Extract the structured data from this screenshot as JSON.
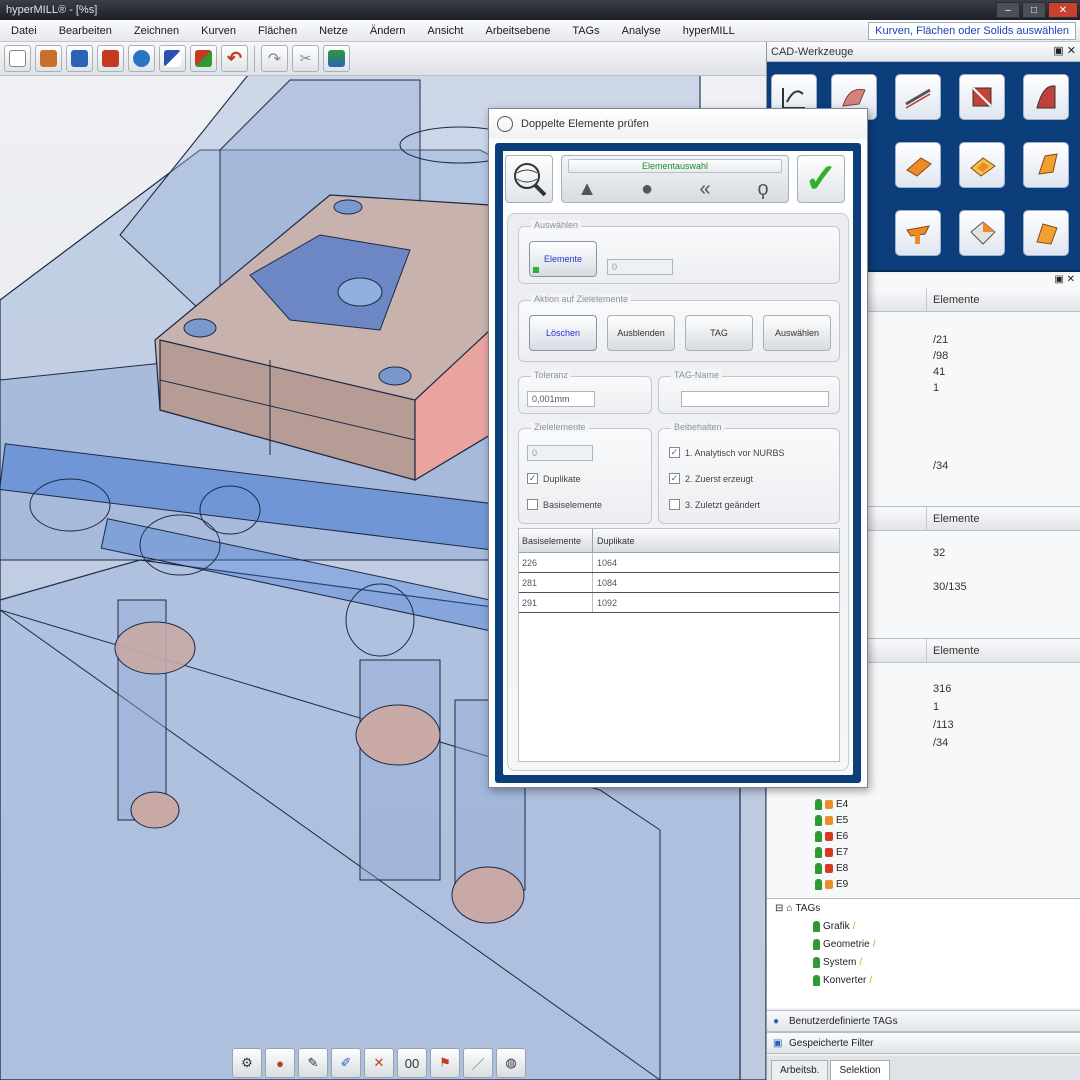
{
  "window": {
    "title": "hyperMILL® - [%s]"
  },
  "menu": {
    "items": [
      "Datei",
      "Bearbeiten",
      "Zeichnen",
      "Kurven",
      "Flächen",
      "Netze",
      "Ändern",
      "Ansicht",
      "Arbeitsebene",
      "TAGs",
      "Analyse",
      "hyperMILL"
    ],
    "hint": "Kurven, Flächen oder Solids auswählen"
  },
  "toolbar": {
    "icons": [
      "new-file-icon",
      "open-folder-icon",
      "save-icon",
      "book-icon",
      "tool-wheel-icon",
      "pencil-blue-icon",
      "pencil-red-icon",
      "undo-icon",
      "redo-icon",
      "cut-icon",
      "paste-icon"
    ]
  },
  "cad_tools": {
    "title": "CAD-Werkzeuge",
    "controls": "▣ ✕"
  },
  "elements_panels": [
    {
      "header": "Elemente",
      "values": [
        "/21",
        "/98",
        "41",
        "1",
        "/34"
      ]
    },
    {
      "header": "Elemente",
      "values": [
        "32",
        "30/135"
      ]
    },
    {
      "header": "Elemente",
      "values": [
        "316",
        "1",
        "/113",
        "/34"
      ]
    }
  ],
  "layer_tree": {
    "items": [
      {
        "label": "E4",
        "color": "#e8912a"
      },
      {
        "label": "E5",
        "color": "#e8912a"
      },
      {
        "label": "E6",
        "color": "#d33a22"
      },
      {
        "label": "E7",
        "color": "#d33a22"
      },
      {
        "label": "E8",
        "color": "#d33a22"
      },
      {
        "label": "E9",
        "color": "#e8912a"
      }
    ]
  },
  "tags_tree": {
    "root": "TAGs",
    "items": [
      "Grafik",
      "Geometrie",
      "System",
      "Konverter"
    ]
  },
  "footer": {
    "user_tags": "Benutzerdefinierte TAGs",
    "saved_filter": "Gespeicherte Filter",
    "tabs": [
      "Arbeitsb.",
      "Selektion"
    ]
  },
  "dialog": {
    "title": "Doppelte Elemente prüfen",
    "action_bar_label": "Elementauswahl",
    "selection": {
      "group_title": "Auswählen",
      "button": "Elemente",
      "count": "0"
    },
    "action": {
      "group_title": "Aktion auf Zielelemente",
      "buttons": [
        "Löschen",
        "Ausblenden",
        "TAG",
        "Auswählen"
      ]
    },
    "tolerance": {
      "group_title": "Toleranz",
      "value": "0,001mm"
    },
    "tag_name": {
      "group_title": "TAG-Name",
      "value": ""
    },
    "target": {
      "group_title": "Zielelemente",
      "count": "0",
      "options": [
        {
          "label": "Duplikate",
          "checked": true
        },
        {
          "label": "Basiselemente",
          "checked": false
        }
      ]
    },
    "keep": {
      "group_title": "Beibehalten",
      "options": [
        {
          "label": "1. Analytisch vor NURBS",
          "checked": true
        },
        {
          "label": "2. Zuerst erzeugt",
          "checked": true
        },
        {
          "label": "3. Zuletzt geändert",
          "checked": false
        }
      ]
    },
    "table": {
      "headers": [
        "Basiselemente",
        "Duplikate"
      ],
      "rows": [
        [
          "226",
          "1064"
        ],
        [
          "281",
          "1084"
        ],
        [
          "291",
          "1092"
        ]
      ]
    }
  },
  "bottom_toolbar": {
    "icons": [
      "gear-icon",
      "dots-icon",
      "draw-icon",
      "brush-icon",
      "pin-icon",
      "count-icon",
      "flag-icon",
      "pen-icon",
      "globe-icon"
    ],
    "count_label": "00"
  }
}
